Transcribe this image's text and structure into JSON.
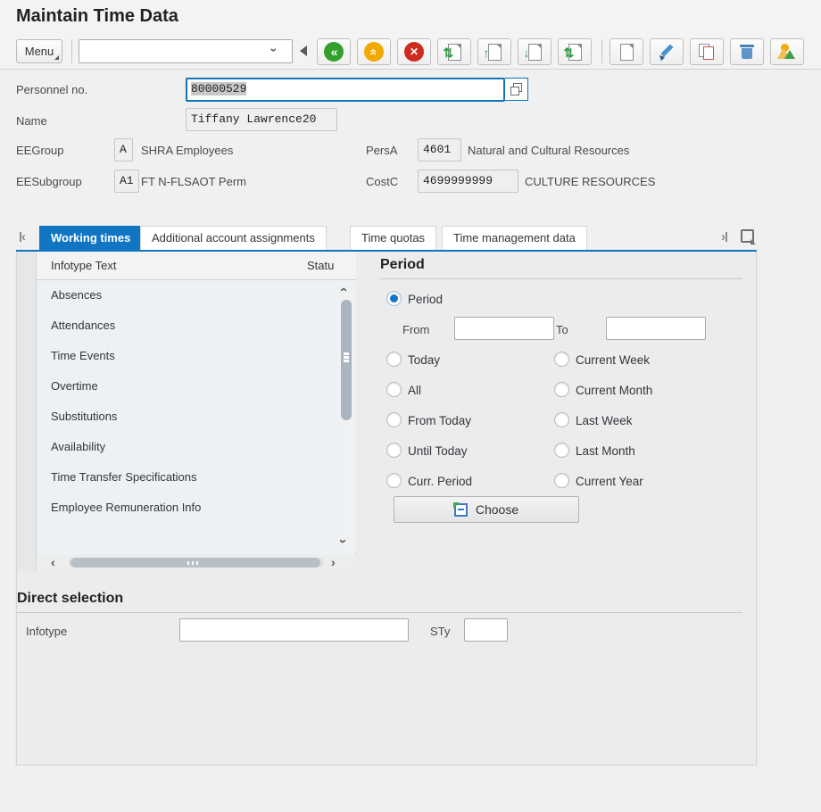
{
  "title": "Maintain Time Data",
  "toolbar": {
    "menu_label": "Menu",
    "command_value": "",
    "icons": [
      "dropdown-chevron-icon",
      "collapse-toolbar-icon",
      "back-icon",
      "exit-icon",
      "cancel-icon",
      "page-first-icon",
      "page-up-icon",
      "page-down-icon",
      "page-last-icon",
      "create-icon",
      "change-icon",
      "copy-icon",
      "delete-icon",
      "overview-icon"
    ]
  },
  "employee": {
    "personnel_label": "Personnel no.",
    "personnel_value": "80000529",
    "name_label": "Name",
    "name_value": "Tiffany Lawrence20",
    "eegroup_label": "EEGroup",
    "eegroup_value": "A",
    "eegroup_text": "SHRA Employees",
    "eesubgroup_label": "EESubgroup",
    "eesubgroup_value": "A1",
    "eesubgroup_text": "FT N-FLSAOT Perm",
    "persa_label": "PersA",
    "persa_value": "4601",
    "persa_text": "Natural and Cultural Resources",
    "costc_label": "CostC",
    "costc_value": "4699999999",
    "costc_text": "CULTURE RESOURCES"
  },
  "tabs": [
    {
      "label": "Working times",
      "active": true
    },
    {
      "label": "Additional account assignments",
      "active": false
    },
    {
      "label": "Time quotas",
      "active": false
    },
    {
      "label": "Time management data",
      "active": false
    }
  ],
  "infotype_table": {
    "col_text": "Infotype Text",
    "col_status": "Statu",
    "rows": [
      "Absences",
      "Attendances",
      "Time Events",
      "Overtime",
      "Substitutions",
      "Availability",
      "Time Transfer Specifications",
      "Employee Remuneration Info"
    ]
  },
  "period": {
    "heading": "Period",
    "selected": "Period",
    "from_label": "From",
    "from_value": "",
    "to_label": "To",
    "to_value": "",
    "options_left": [
      "Period",
      "Today",
      "All",
      "From Today",
      "Until Today",
      "Curr. Period"
    ],
    "options_right": [
      "Current Week",
      "Current Month",
      "Last Week",
      "Last Month",
      "Current Year"
    ],
    "choose_label": "Choose"
  },
  "direct_selection": {
    "heading": "Direct selection",
    "infotype_label": "Infotype",
    "infotype_value": "",
    "sty_label": "STy",
    "sty_value": ""
  },
  "colors": {
    "accent_blue": "#1076c4",
    "back_green": "#33a02c",
    "exit_orange": "#f2a900",
    "cancel_red": "#cc2b1d",
    "row_bg": "#edf1f4"
  }
}
